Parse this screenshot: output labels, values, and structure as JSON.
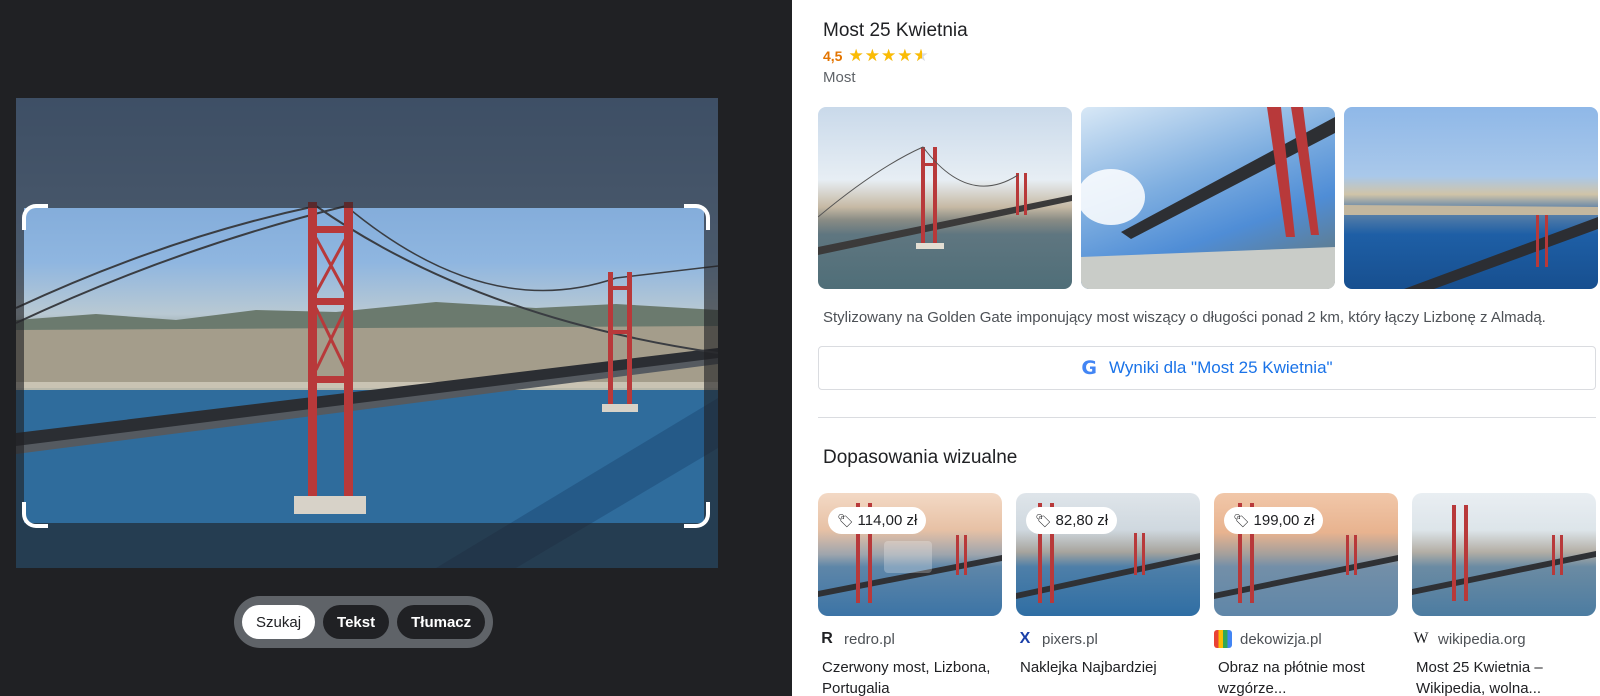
{
  "lens": {
    "modes": [
      {
        "label": "Szukaj",
        "active": true
      },
      {
        "label": "Tekst",
        "active": false
      },
      {
        "label": "Tłumacz",
        "active": false
      }
    ]
  },
  "entity": {
    "title": "Most 25 Kwietnia",
    "rating": "4,5",
    "rating_value": 4.5,
    "rating_max": 5,
    "type": "Most",
    "description": "Stylizowany na Golden Gate imponujący most wiszący o długości ponad 2 km, który łączy Lizbonę z Almadą.",
    "search_button": "Wyniki dla \"Most 25 Kwietnia\""
  },
  "visual_matches": {
    "title": "Dopasowania wizualne",
    "items": [
      {
        "price": "114,00 zł",
        "source": "redro.pl",
        "source_icon": "R",
        "title": "Czerwony most, Lizbona, Portugalia"
      },
      {
        "price": "82,80 zł",
        "source": "pixers.pl",
        "source_icon": "X",
        "title": "Naklejka Najbardziej"
      },
      {
        "price": "199,00 zł",
        "source": "dekowizja.pl",
        "source_icon": "dekowizja-logo",
        "title": "Obraz na płótnie most wzgórze..."
      },
      {
        "price": null,
        "source": "wikipedia.org",
        "source_icon": "W",
        "title": "Most 25 Kwietnia – Wikipedia, wolna..."
      }
    ]
  },
  "colors": {
    "accent": "#1a73e8",
    "rating": "#e37400",
    "star": "#fbbc04",
    "bridge": "#b8393a"
  }
}
